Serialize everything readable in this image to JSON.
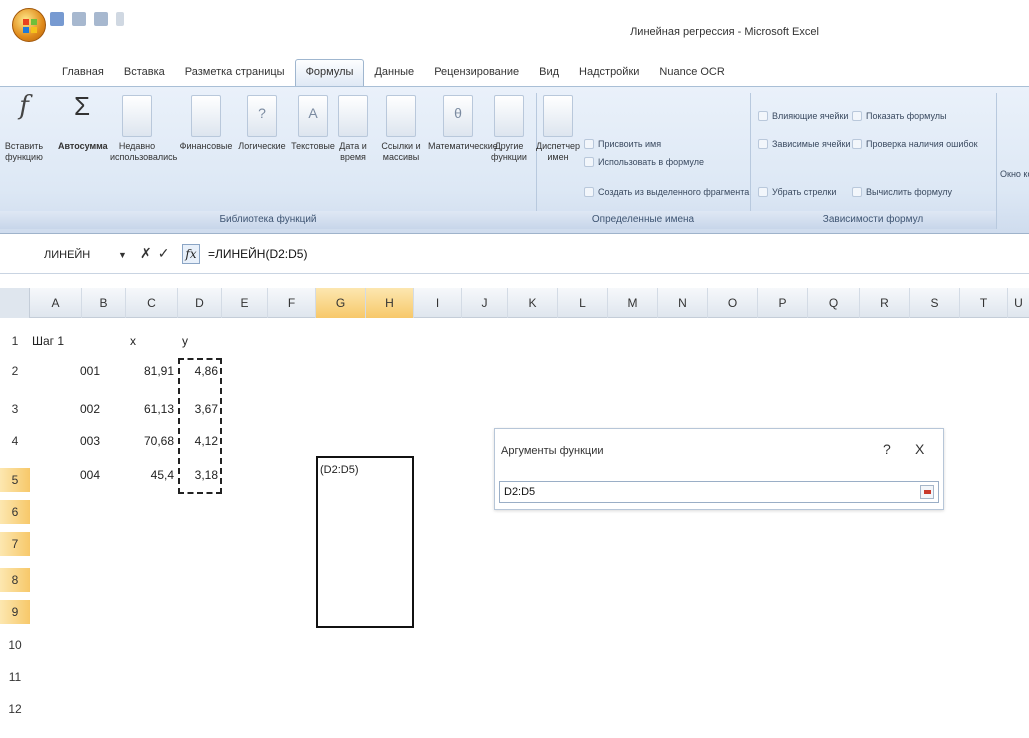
{
  "window": {
    "title": "Линейная регрессия - Microsoft Excel"
  },
  "tabs": [
    "Главная",
    "Вставка",
    "Разметка страницы",
    "Формулы",
    "Данные",
    "Рецензирование",
    "Вид",
    "Надстройки",
    "Nuance OCR"
  ],
  "active_tab": "Формулы",
  "ribbon": {
    "insert_function": "Вставить функцию",
    "autosum": "Автосумма",
    "recent": "Недавно использовались",
    "financial": "Финансовые",
    "logical": "Логические",
    "text": "Текстовые",
    "datetime": "Дата и время",
    "lookup": "Ссылки и массивы",
    "math": "Математические",
    "other": "Другие функции",
    "name_manager": "Диспетчер имен",
    "assign_name": "Присвоить имя",
    "use_in_formula": "Использовать в формуле",
    "create_from_selection": "Создать из выделенного фрагмента",
    "trace_precedents": "Влияющие ячейки",
    "trace_dependents": "Зависимые ячейки",
    "remove_arrows": "Убрать стрелки",
    "show_formulas": "Показать формулы",
    "error_check": "Проверка наличия ошибок",
    "evaluate_formula": "Вычислить формулу",
    "watch_window": "Окно контрольного значения",
    "group_library": "Библиотека функций",
    "group_names": "Определенные имена",
    "group_audit": "Зависимости формул"
  },
  "formula_bar": {
    "name_box": "ЛИНЕЙН",
    "formula": "=ЛИНЕЙН(D2:D5)"
  },
  "grid": {
    "columns": [
      "A",
      "B",
      "C",
      "D",
      "E",
      "F",
      "G",
      "H",
      "I",
      "J",
      "K",
      "L",
      "M",
      "N",
      "O",
      "P",
      "Q",
      "R",
      "S",
      "T",
      "U"
    ],
    "rows": [
      "1",
      "2",
      "3",
      "4",
      "5",
      "6",
      "7",
      "8",
      "9",
      "10",
      "11",
      "12"
    ],
    "a1": "Шаг 1",
    "c1": "x",
    "d1": "y",
    "data": [
      {
        "b": "001",
        "c": "81,91",
        "d": "4,86"
      },
      {
        "b": "002",
        "c": "61,13",
        "d": "3,67"
      },
      {
        "b": "003",
        "c": "70,68",
        "d": "4,12"
      },
      {
        "b": "004",
        "c": "45,4",
        "d": "3,18"
      }
    ],
    "edit_cell_text": "(D2:D5)"
  },
  "dialog": {
    "title": "Аргументы функции",
    "help": "?",
    "close": "X",
    "input_value": "D2:D5"
  }
}
